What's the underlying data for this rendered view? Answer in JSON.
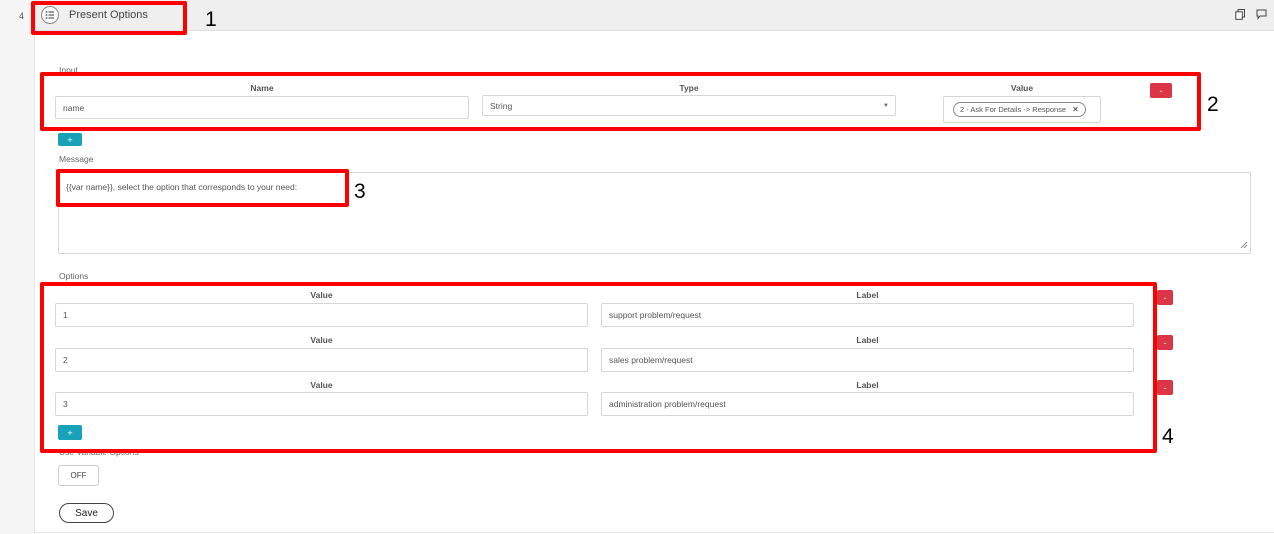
{
  "step": {
    "number": "4",
    "title": "Present Options"
  },
  "input_section": {
    "label": "Input",
    "col_name": "Name",
    "col_type": "Type",
    "col_value": "Value",
    "name_value": "name",
    "type_value": "String",
    "value_tag": "2 - Ask For Details -> Response",
    "remove_label": "-",
    "add_label": "+"
  },
  "message_section": {
    "label": "Message",
    "text": "{{var name}}, select the option that corresponds to your need:"
  },
  "options_section": {
    "label": "Options",
    "col_value": "Value",
    "col_label": "Label",
    "rows": [
      {
        "value": "1",
        "label": "support problem/request"
      },
      {
        "value": "2",
        "label": "sales problem/request"
      },
      {
        "value": "3",
        "label": "administration problem/request"
      }
    ],
    "remove_label": "-",
    "add_label": "+"
  },
  "variable_options": {
    "label": "Use Variable Options",
    "toggle_state": "OFF"
  },
  "save_label": "Save",
  "annotations": {
    "a1": "1",
    "a2": "2",
    "a3": "3",
    "a4": "4"
  },
  "icons": [
    "list-icon",
    "copy-icon",
    "comment-icon",
    "clear-icon",
    "resize-grip-icon"
  ],
  "colors": {
    "danger": "#dc3545",
    "info": "#17a2b8",
    "highlight": "#ff0000"
  }
}
